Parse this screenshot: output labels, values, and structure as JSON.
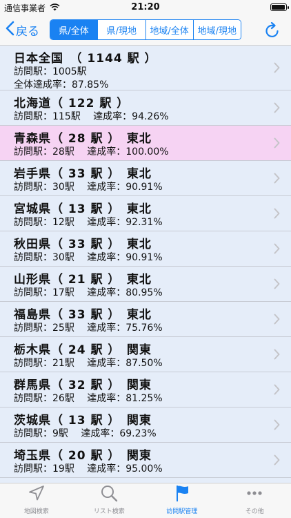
{
  "status": {
    "carrier": "通信事業者",
    "time": "21:20"
  },
  "nav": {
    "back_label": "戻る",
    "segments": [
      "県/全体",
      "県/現地",
      "地域/全体",
      "地域/現地"
    ],
    "active_segment": 0
  },
  "colors": {
    "accent": "#1a82f2",
    "row_bg": "#e5edf9",
    "highlight_bg": "#f6d3f3"
  },
  "list": [
    {
      "title": "日本全国　（ 1144 駅 ）",
      "line1": "訪問駅：1005駅",
      "line2": "全体達成率：87.85%"
    },
    {
      "title": "北海道（ 122 駅 ）",
      "line1": "訪問駅：115駅　 達成率：94.26%"
    },
    {
      "title": "青森県（ 28 駅 ）　東北",
      "line1": "訪問駅：28駅　 達成率：100.00%",
      "highlight": true
    },
    {
      "title": "岩手県（ 33 駅 ）　東北",
      "line1": "訪問駅：30駅　 達成率：90.91%"
    },
    {
      "title": "宮城県（ 13 駅 ）　東北",
      "line1": "訪問駅：12駅　 達成率：92.31%"
    },
    {
      "title": "秋田県（ 33 駅 ）　東北",
      "line1": "訪問駅：30駅　 達成率：90.91%"
    },
    {
      "title": "山形県（ 21 駅 ）　東北",
      "line1": "訪問駅：17駅　 達成率：80.95%"
    },
    {
      "title": "福島県（ 33 駅 ）　東北",
      "line1": "訪問駅：25駅　 達成率：75.76%"
    },
    {
      "title": "栃木県（ 24 駅 ）　関東",
      "line1": "訪問駅：21駅　 達成率：87.50%"
    },
    {
      "title": "群馬県（ 32 駅 ）　関東",
      "line1": "訪問駅：26駅　 達成率：81.25%"
    },
    {
      "title": "茨城県（ 13 駅 ）　関東",
      "line1": "訪問駅：9駅　 達成率：69.23%"
    },
    {
      "title": "埼玉県（ 20 駅 ）　関東",
      "line1": "訪問駅：19駅　 達成率：95.00%"
    }
  ],
  "tabs": [
    {
      "label": "地図検索",
      "icon": "location-arrow-icon"
    },
    {
      "label": "リスト検索",
      "icon": "magnifier-icon"
    },
    {
      "label": "訪問駅管理",
      "icon": "flag-icon",
      "active": true
    },
    {
      "label": "その他",
      "icon": "more-dots-icon"
    }
  ]
}
